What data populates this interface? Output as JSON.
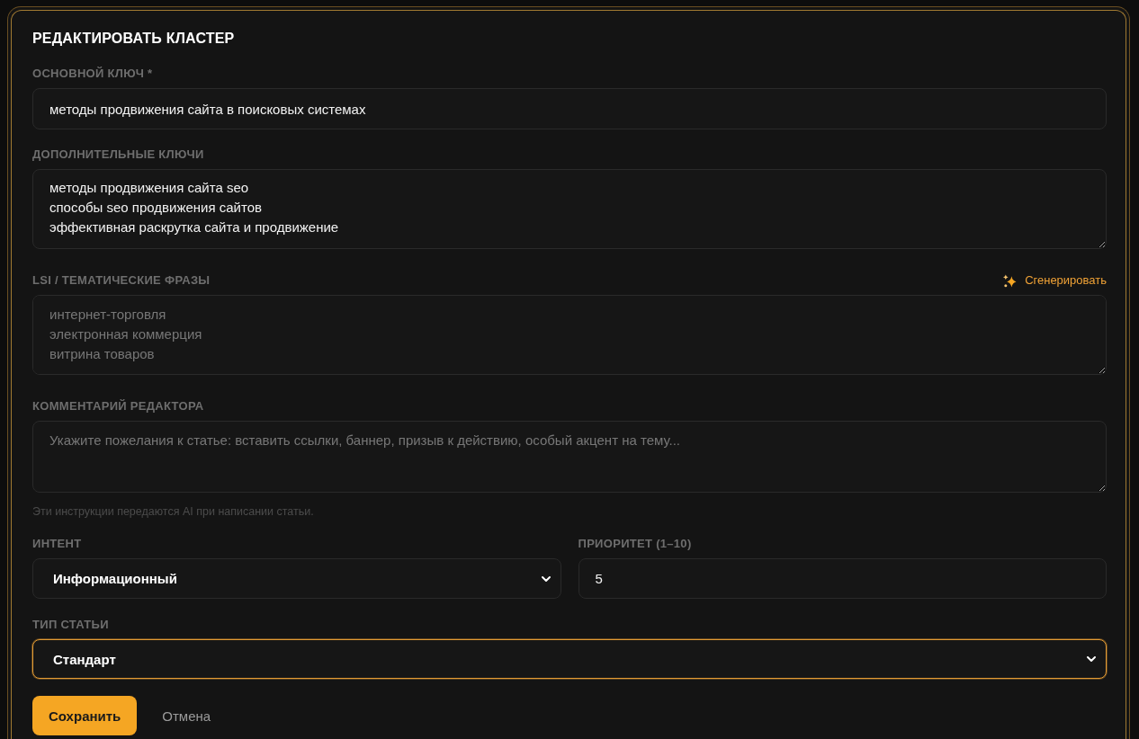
{
  "dialog": {
    "title": "РЕДАКТИРОВАТЬ КЛАСТЕР"
  },
  "main_key": {
    "label": "ОСНОВНОЙ КЛЮЧ *",
    "value": "методы продвижения сайта в поисковых системах",
    "focused": false
  },
  "extra_keys": {
    "label": "ДОПОЛНИТЕЛЬНЫЕ КЛЮЧИ",
    "value": "методы продвижения сайта seo\nспособы seo продвижения сайтов\nэффективная раскрутка сайта и продвижение",
    "focused": false
  },
  "lsi": {
    "label": "LSI / ТЕМАТИЧЕСКИЕ ФРАЗЫ",
    "action": "Сгенерировать",
    "placeholder": "интернет-торговля\nэлектронная коммерция\nвитрина товаров",
    "focused": false
  },
  "editor_comment": {
    "label": "КОММЕНТАРИЙ РЕДАКТОРА",
    "placeholder": "Укажите пожелания к статье: вставить ссылки, баннер, призыв к действию, особый акцент на тему...",
    "hint": "Эти инструкции передаются AI при написании статьи.",
    "focused": false
  },
  "intent": {
    "label": "ИНТЕНТ",
    "value": "Информационный",
    "focused": false
  },
  "priority": {
    "label": "ПРИОРИТЕТ (1–10)",
    "value": "5",
    "focused": false
  },
  "article_type": {
    "label": "ТИП СТАТЬИ",
    "value": "Стандарт",
    "focused": true
  },
  "buttons": [
    {
      "label": "Сохранить",
      "kind": "primary"
    },
    {
      "label": "Отмена",
      "kind": "secondary"
    }
  ]
}
